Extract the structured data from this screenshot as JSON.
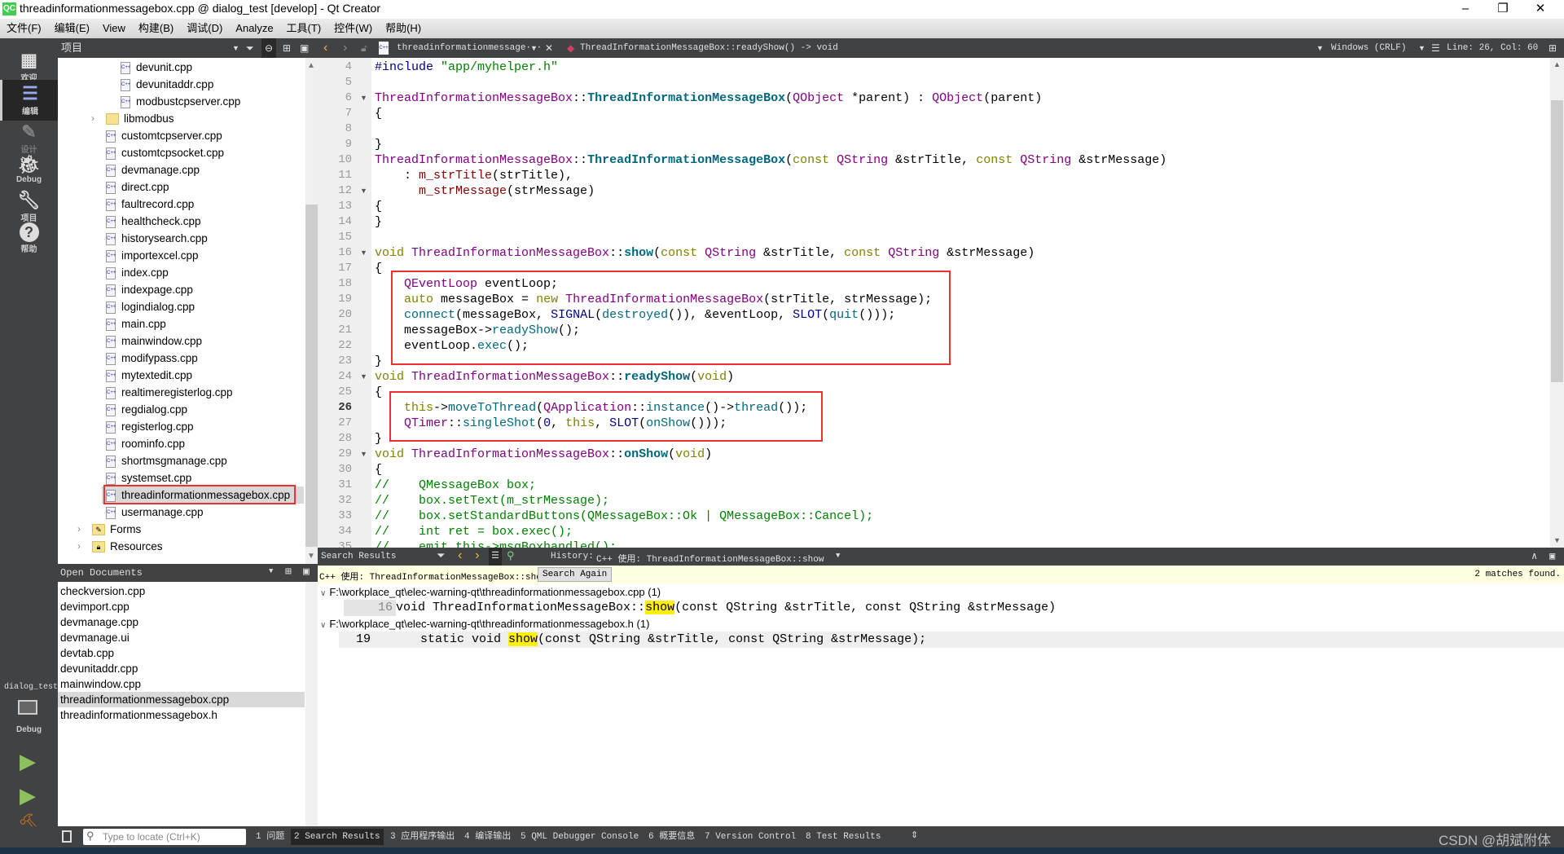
{
  "window": {
    "title": "threadinformationmessagebox.cpp @ dialog_test [develop] - Qt Creator",
    "logo": "QC",
    "minimize": "–",
    "restore": "❐",
    "close": "✕"
  },
  "menu": [
    "文件(F)",
    "编辑(E)",
    "View",
    "构建(B)",
    "调试(D)",
    "Analyze",
    "工具(T)",
    "控件(W)",
    "帮助(H)"
  ],
  "project_panel": {
    "title": "项目"
  },
  "editor_toolbar": {
    "file_combo": "threadinformationmessage···",
    "symbol": "ThreadInformationMessageBox::readyShow() -> void",
    "line_ending": "Windows (CRLF)",
    "position": "Line: 26, Col: 60"
  },
  "modes": [
    {
      "label": "欢迎",
      "icon": "grid-icon"
    },
    {
      "label": "编辑",
      "icon": "edit-icon",
      "active": true
    },
    {
      "label": "设计",
      "icon": "pencil-icon",
      "disabled": true
    },
    {
      "label": "Debug",
      "icon": "bug-icon"
    },
    {
      "label": "项目",
      "icon": "wrench-icon"
    },
    {
      "label": "帮助",
      "icon": "help-icon"
    }
  ],
  "kit": {
    "project": "dialog_test",
    "build": "Debug"
  },
  "tree": [
    {
      "label": "devunit.cpp",
      "depth": 3,
      "type": "cpp"
    },
    {
      "label": "devunitaddr.cpp",
      "depth": 3,
      "type": "cpp"
    },
    {
      "label": "modbustcpserver.cpp",
      "depth": 3,
      "type": "cpp"
    },
    {
      "label": "libmodbus",
      "depth": 2,
      "type": "folder",
      "collapsed": true
    },
    {
      "label": "customtcpserver.cpp",
      "depth": 2,
      "type": "cpp"
    },
    {
      "label": "customtcpsocket.cpp",
      "depth": 2,
      "type": "cpp"
    },
    {
      "label": "devmanage.cpp",
      "depth": 2,
      "type": "cpp"
    },
    {
      "label": "direct.cpp",
      "depth": 2,
      "type": "cpp"
    },
    {
      "label": "faultrecord.cpp",
      "depth": 2,
      "type": "cpp"
    },
    {
      "label": "healthcheck.cpp",
      "depth": 2,
      "type": "cpp"
    },
    {
      "label": "historysearch.cpp",
      "depth": 2,
      "type": "cpp"
    },
    {
      "label": "importexcel.cpp",
      "depth": 2,
      "type": "cpp"
    },
    {
      "label": "index.cpp",
      "depth": 2,
      "type": "cpp"
    },
    {
      "label": "indexpage.cpp",
      "depth": 2,
      "type": "cpp"
    },
    {
      "label": "logindialog.cpp",
      "depth": 2,
      "type": "cpp"
    },
    {
      "label": "main.cpp",
      "depth": 2,
      "type": "cpp"
    },
    {
      "label": "mainwindow.cpp",
      "depth": 2,
      "type": "cpp"
    },
    {
      "label": "modifypass.cpp",
      "depth": 2,
      "type": "cpp"
    },
    {
      "label": "mytextedit.cpp",
      "depth": 2,
      "type": "cpp"
    },
    {
      "label": "realtimeregisterlog.cpp",
      "depth": 2,
      "type": "cpp"
    },
    {
      "label": "regdialog.cpp",
      "depth": 2,
      "type": "cpp"
    },
    {
      "label": "registerlog.cpp",
      "depth": 2,
      "type": "cpp"
    },
    {
      "label": "roominfo.cpp",
      "depth": 2,
      "type": "cpp"
    },
    {
      "label": "shortmsgmanage.cpp",
      "depth": 2,
      "type": "cpp"
    },
    {
      "label": "systemset.cpp",
      "depth": 2,
      "type": "cpp"
    },
    {
      "label": "threadinformationmessagebox.cpp",
      "depth": 2,
      "type": "cpp",
      "selected": true
    },
    {
      "label": "usermanage.cpp",
      "depth": 2,
      "type": "cpp"
    },
    {
      "label": "Forms",
      "depth": 1,
      "type": "forms",
      "collapsed": true
    },
    {
      "label": "Resources",
      "depth": 1,
      "type": "resources",
      "collapsed": true
    }
  ],
  "open_documents": {
    "title": "Open Documents",
    "items": [
      "checkversion.cpp",
      "devimport.cpp",
      "devmanage.cpp",
      "devmanage.ui",
      "devtab.cpp",
      "devunitaddr.cpp",
      "mainwindow.cpp",
      "threadinformationmessagebox.cpp",
      "threadinformationmessagebox.h"
    ],
    "selected": 7
  },
  "code": {
    "first_line": 4,
    "current_line": 26,
    "fold_lines": [
      6,
      12,
      16,
      24,
      29
    ],
    "lines": [
      [
        [
          "#include ",
          "m"
        ],
        [
          "\"app/myhelper.h\"",
          "s"
        ]
      ],
      [],
      [
        [
          "ThreadInformationMessageBox",
          "t"
        ],
        [
          "::",
          "p"
        ],
        [
          "ThreadInformationMessageBox",
          "f"
        ],
        [
          "(",
          "p"
        ],
        [
          "QObject",
          "t"
        ],
        [
          " *parent) : ",
          "p"
        ],
        [
          "QObject",
          "t"
        ],
        [
          "(parent)",
          "p"
        ]
      ],
      [
        [
          "{",
          "p"
        ]
      ],
      [],
      [
        [
          "}",
          "p"
        ]
      ],
      [
        [
          "ThreadInformationMessageBox",
          "t"
        ],
        [
          "::",
          "p"
        ],
        [
          "ThreadInformationMessageBox",
          "f"
        ],
        [
          "(",
          "p"
        ],
        [
          "const ",
          "k"
        ],
        [
          "QString",
          "t"
        ],
        [
          " &strTitle, ",
          "p"
        ],
        [
          "const ",
          "k"
        ],
        [
          "QString",
          "t"
        ],
        [
          " &strMessage)",
          "p"
        ]
      ],
      [
        [
          "    : ",
          "p"
        ],
        [
          "m_strTitle",
          "v"
        ],
        [
          "(strTitle),",
          "p"
        ]
      ],
      [
        [
          "      ",
          "p"
        ],
        [
          "m_strMessage",
          "v"
        ],
        [
          "(strMessage)",
          "p"
        ]
      ],
      [
        [
          "{",
          "p"
        ]
      ],
      [
        [
          "}",
          "p"
        ]
      ],
      [],
      [
        [
          "void ",
          "k"
        ],
        [
          "ThreadInformationMessageBox",
          "t"
        ],
        [
          "::",
          "p"
        ],
        [
          "show",
          "f"
        ],
        [
          "(",
          "p"
        ],
        [
          "const ",
          "k"
        ],
        [
          "QString",
          "t"
        ],
        [
          " &strTitle, ",
          "p"
        ],
        [
          "const ",
          "k"
        ],
        [
          "QString",
          "t"
        ],
        [
          " &strMessage)",
          "p"
        ]
      ],
      [
        [
          "{",
          "p"
        ]
      ],
      [
        [
          "    ",
          "p"
        ],
        [
          "QEventLoop",
          "t"
        ],
        [
          " eventLoop;",
          "p"
        ]
      ],
      [
        [
          "    ",
          "p"
        ],
        [
          "auto",
          "k"
        ],
        [
          " messageBox = ",
          "p"
        ],
        [
          "new ",
          "k"
        ],
        [
          "ThreadInformationMessageBox",
          "t"
        ],
        [
          "(strTitle, strMessage);",
          "p"
        ]
      ],
      [
        [
          "    ",
          "p"
        ],
        [
          "connect",
          "fn"
        ],
        [
          "(messageBox, ",
          "p"
        ],
        [
          "SIGNAL",
          "m"
        ],
        [
          "(",
          "p"
        ],
        [
          "destroyed",
          "fn"
        ],
        [
          "()), &eventLoop, ",
          "p"
        ],
        [
          "SLOT",
          "m"
        ],
        [
          "(",
          "p"
        ],
        [
          "quit",
          "fn"
        ],
        [
          "()));",
          "p"
        ]
      ],
      [
        [
          "    messageBox->",
          "p"
        ],
        [
          "readyShow",
          "fn"
        ],
        [
          "();",
          "p"
        ]
      ],
      [
        [
          "    eventLoop.",
          "p"
        ],
        [
          "exec",
          "fn"
        ],
        [
          "();",
          "p"
        ]
      ],
      [
        [
          "}",
          "p"
        ]
      ],
      [
        [
          "void ",
          "k"
        ],
        [
          "ThreadInformationMessageBox",
          "t"
        ],
        [
          "::",
          "p"
        ],
        [
          "readyShow",
          "f"
        ],
        [
          "(",
          "p"
        ],
        [
          "void",
          "k"
        ],
        [
          ")",
          "p"
        ]
      ],
      [
        [
          "{",
          "p"
        ]
      ],
      [
        [
          "    ",
          "p"
        ],
        [
          "this",
          "k"
        ],
        [
          "->",
          "p"
        ],
        [
          "moveToThread",
          "fn"
        ],
        [
          "(",
          "p"
        ],
        [
          "QApplication",
          "t"
        ],
        [
          "::",
          "p"
        ],
        [
          "instance",
          "fn"
        ],
        [
          "()->",
          "p"
        ],
        [
          "thread",
          "fn"
        ],
        [
          "());",
          "p"
        ]
      ],
      [
        [
          "    ",
          "p"
        ],
        [
          "QTimer",
          "t"
        ],
        [
          "::",
          "p"
        ],
        [
          "singleShot",
          "fn"
        ],
        [
          "(",
          "p"
        ],
        [
          "0",
          "m"
        ],
        [
          ", ",
          "p"
        ],
        [
          "this",
          "k"
        ],
        [
          ", ",
          "p"
        ],
        [
          "SLOT",
          "m"
        ],
        [
          "(",
          "p"
        ],
        [
          "onShow",
          "fn"
        ],
        [
          "()));",
          "p"
        ]
      ],
      [
        [
          "}",
          "p"
        ]
      ],
      [
        [
          "void ",
          "k"
        ],
        [
          "ThreadInformationMessageBox",
          "t"
        ],
        [
          "::",
          "p"
        ],
        [
          "onShow",
          "f"
        ],
        [
          "(",
          "p"
        ],
        [
          "void",
          "k"
        ],
        [
          ")",
          "p"
        ]
      ],
      [
        [
          "{",
          "p"
        ]
      ],
      [
        [
          "//    QMessageBox box;",
          "c"
        ]
      ],
      [
        [
          "//    box.setText(m_strMessage);",
          "c"
        ]
      ],
      [
        [
          "//    box.setStandardButtons(QMessageBox::Ok | QMessageBox::Cancel);",
          "c"
        ]
      ],
      [
        [
          "//    int ret = box.exec();",
          "c"
        ]
      ],
      [
        [
          "//    emit this->msgBoxhandled();",
          "c"
        ]
      ]
    ]
  },
  "search": {
    "title": "Search Results",
    "history_label": "History:",
    "history_value": "C++ 使用: ThreadInformationMessageBox::show",
    "query": "C++ 使用: ThreadInformationMessageBox::show",
    "search_again": "Search Again",
    "matches": "2 matches found.",
    "results": [
      {
        "path": "F:\\workplace_qt\\elec-warning-qt\\threadinformationmessagebox.cpp (1)",
        "line": "16",
        "before": "void ThreadInformationMessageBox::",
        "match": "show",
        "after": "(const QString &strTitle, const QString &strMessage)"
      },
      {
        "path": "F:\\workplace_qt\\elec-warning-qt\\threadinformationmessagebox.h (1)",
        "line": "19",
        "before": "    static void ",
        "match": "show",
        "after": "(const QString &strTitle, const QString &strMessage);"
      }
    ]
  },
  "statusbar": {
    "locate_placeholder": "Type to locate (Ctrl+K)",
    "tabs": [
      "1 问题",
      "2 Search Results",
      "3 应用程序输出",
      "4 编译输出",
      "5 QML Debugger Console",
      "6 概要信息",
      "7 Version Control",
      "8 Test Results"
    ],
    "active_tab": 1,
    "watermark": "CSDN @胡斌附体"
  },
  "colors": {
    "sidebar": "#404244",
    "highlight_box": "#f03030",
    "match_highlight": "#ffef0b",
    "info_bar": "#ffffe1"
  }
}
